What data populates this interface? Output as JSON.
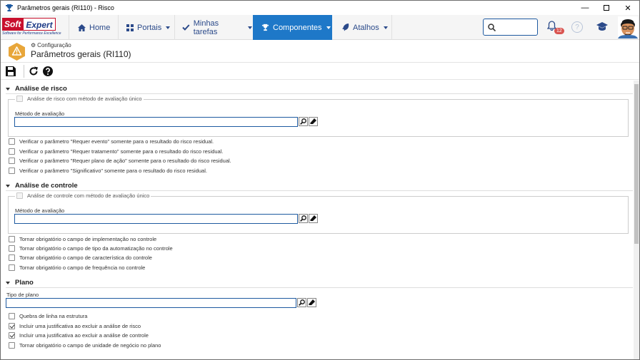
{
  "window": {
    "title": "Parâmetros gerais (RI110) - Risco"
  },
  "logo": {
    "brand1": "Soft",
    "brand2": "Expert",
    "tagline": "Software for Performance Excellence"
  },
  "nav": {
    "items": [
      {
        "label": "Home"
      },
      {
        "label": "Portais"
      },
      {
        "label": "Minhas tarefas"
      },
      {
        "label": "Componentes"
      },
      {
        "label": "Atalhos"
      }
    ],
    "notif_count": "12",
    "help": "?"
  },
  "header": {
    "breadcrumb": "Configuração",
    "title": "Parâmetros gerais (RI110)"
  },
  "sections": {
    "risk": {
      "title": "Análise de risco",
      "single_method": "Análise de risco com método de avaliação único",
      "method_label": "Método de avaliação",
      "checks": [
        "Verificar o parâmetro \"Requer evento\" somente para o resultado do risco residual.",
        "Verificar o parâmetro \"Requer tratamento\" somente para o resultado do risco residual.",
        "Verificar o parâmetro \"Requer plano de ação\" somente para o resultado do risco residual.",
        "Verificar o parâmetro \"Significativo\" somente para o resultado do risco residual."
      ]
    },
    "control": {
      "title": "Análise de controle",
      "single_method": "Análise de controle com método de avaliação único",
      "method_label": "Método de avaliação",
      "checks": [
        "Tornar obrigatório o campo de implementação no controle",
        "Tornar obrigatório o campo de tipo da automatização no controle",
        "Tornar obrigatório o campo de característica do controle",
        "Tornar obrigatório o campo de frequência no controle"
      ]
    },
    "plan": {
      "title": "Plano",
      "type_label": "Tipo de plano",
      "checks": [
        {
          "label": "Quebra de linha na estrutura",
          "checked": false
        },
        {
          "label": "Incluir uma justificativa ao excluir a análise de risco",
          "checked": true
        },
        {
          "label": "Incluir uma justificativa ao excluir a análise de controle",
          "checked": true
        },
        {
          "label": "Tornar obrigatório o campo de unidade de negócio no plano",
          "checked": false
        }
      ]
    }
  }
}
